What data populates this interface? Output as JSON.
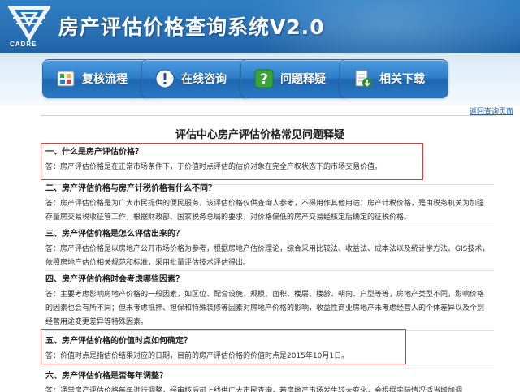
{
  "header": {
    "logo_text": "CADRE",
    "title": "房产评估价格查询系统V2.0"
  },
  "nav": [
    {
      "label": "复核流程",
      "icon": "review-process-icon"
    },
    {
      "label": "在线咨询",
      "icon": "info-icon"
    },
    {
      "label": "问题释疑",
      "icon": "help-icon"
    },
    {
      "label": "相关下载",
      "icon": "download-icon"
    }
  ],
  "back_link": "返回查询页面",
  "page_heading": "评估中心房产评估价格常见问题释疑",
  "faq": [
    {
      "q": "一、什么是房产评估价格？",
      "a": "答：房产评估价格是在正常市场条件下，于价值时点评估的估价对象在完全产权状态下的市场交易价值。"
    },
    {
      "q": "二、房产评估价格与房产计税价格有什么不同？",
      "a": "答：房产评估价格是为广大市民提供的便民服务，该评估价格仅供查询人参考，不得用作其他用途；房产计税价格，是由税务机关为加强存量房交易税收征管工作，根据财政部、国家税务总局的要求，对价格偏低的房产交易经核定后确定的征税价格。"
    },
    {
      "q": "三、房产评估价格是怎么评估出来的？",
      "a": "答：房产评估价格是以房地产公开市场价格为参考，根据房地产估价理论，综合采用比较法、收益法、成本法以及统计学方法、GIS技术，依照房地产估价相关规范和标准，采用批量评估技术评估得出。"
    },
    {
      "q": "四、房产评估价格时会考虑哪些因素？",
      "a": "答：主要考虑影响房地产价格的一般因素，如区位、配套设施、规模、面积、楼层、楼龄、朝向、户型等等，房地产类型不同，影响价格的因素也会有所不同；但未考虑抵押、担保和特殊装修等因素对房地产价格的影响，收益性商业房地产未考虑经营人的个体差异以及个别经营用途变更差异等特殊因素。"
    },
    {
      "q": "五、房产评估价格的价值时点如何确定？",
      "a": "答：价值时点是指估价结果对应的日期，目前的房产评估价格的价值时点是2015年10月1日。"
    },
    {
      "q": "六、房产评估价格是否每年调整？",
      "a": "答：通常房产评估价格每年进行调整，经审核后可上线供广大市民查询，若房地产市场发生较大变化，会根据实际情况适当增加调"
    }
  ],
  "colors": {
    "header_blue": "#2a72b6",
    "button_blue": "#2c7cc9",
    "highlight_red": "#d63a3a",
    "link_blue": "#1a5fb4"
  }
}
